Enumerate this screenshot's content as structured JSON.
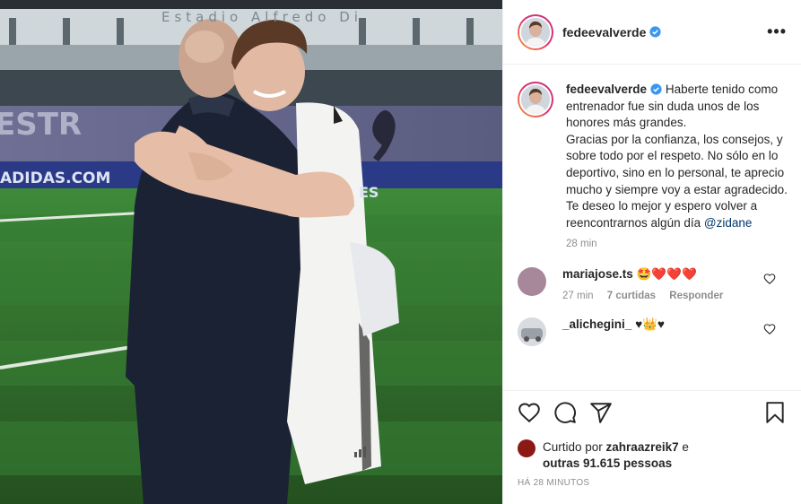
{
  "photo": {
    "stadium_sign": "Estadio Alfredo Di",
    "board_text": "ESTR",
    "sponsor": "ADIDAS.COM",
    "sponsor_tail": "ES"
  },
  "post": {
    "username": "fedeevalverde",
    "verified": true,
    "more_label": "•••",
    "caption_user": "fedeevalverde",
    "caption_text": "Haberte tenido como entrenador fue sin duda unos de los honores más grandes.\nGracias por la confianza, los consejos, y sobre todo por el respeto. No sólo en lo deportivo, sino en lo personal, te aprecio mucho y siempre voy a estar agradecido.\nTe deseo lo mejor y espero volver a reencontrarnos algún día ",
    "caption_mention": "@zidane",
    "caption_time": "28 min"
  },
  "comments": [
    {
      "user": "mariajose.ts",
      "text": "🤩❤️❤️❤️",
      "time": "27 min",
      "likes": "7 curtidas",
      "reply": "Responder"
    },
    {
      "user": "_alichegini_",
      "text": "♥👑♥"
    }
  ],
  "likes": {
    "prefix": "Curtido por ",
    "user": "zahraazreik7",
    "middle": " e",
    "others": "outras 91.615 pessoas",
    "ago": "HÁ 28 MINUTOS"
  },
  "colors": {
    "text": "#262626",
    "muted": "#8e8e8e",
    "link": "#00376b",
    "verified": "#3897f0"
  }
}
